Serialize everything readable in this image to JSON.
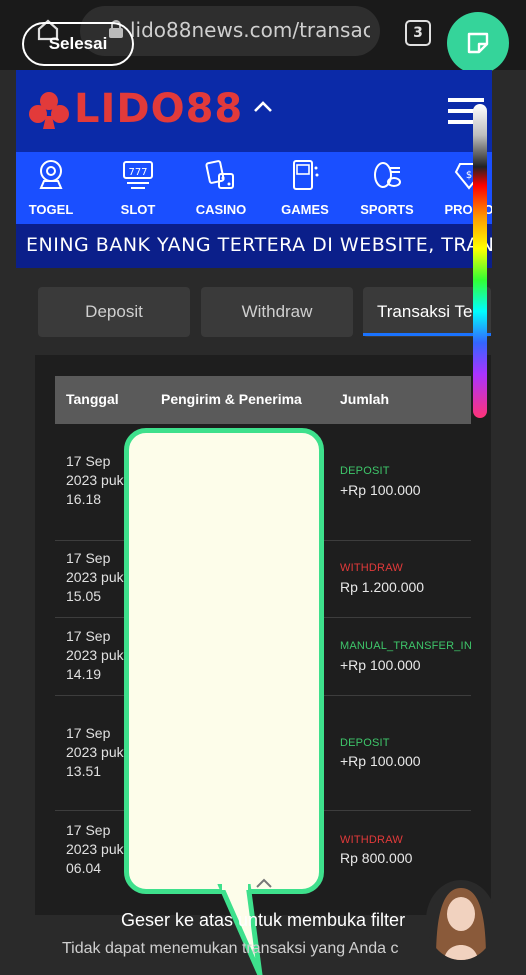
{
  "browser": {
    "url": "lido88news.com/transac",
    "tab_count": "3",
    "done_label": "Selesai"
  },
  "header": {
    "logo_text": "LIDO88"
  },
  "nav": {
    "items": [
      {
        "label": "TOGEL",
        "icon": "lottery-icon"
      },
      {
        "label": "SLOT",
        "icon": "slot-machine-icon"
      },
      {
        "label": "CASINO",
        "icon": "cards-dice-icon"
      },
      {
        "label": "GAMES",
        "icon": "arcade-icon"
      },
      {
        "label": "SPORTS",
        "icon": "sports-icon"
      },
      {
        "label": "PROMO",
        "icon": "promo-icon"
      }
    ]
  },
  "marquee": {
    "text": "ENING BANK YANG TERTERA DI WEBSITE, TRANS"
  },
  "tabs": [
    {
      "label": "Deposit"
    },
    {
      "label": "Withdraw"
    },
    {
      "label": "Transaksi Te"
    }
  ],
  "table": {
    "headers": [
      "Tanggal",
      "Pengirim & Penerima",
      "Jumlah"
    ],
    "rows": [
      {
        "date": "17 Sep 2023 puk 16.18",
        "type": "DEPOSIT",
        "amount": "+Rp 100.000",
        "status": "green"
      },
      {
        "date": "17 Sep 2023 puk 15.05",
        "type": "WITHDRAW",
        "amount": "Rp 1.200.000",
        "status": "red"
      },
      {
        "date": "17 Sep 2023 puk 14.19",
        "type": "MANUAL_TRANSFER_IN",
        "amount": "+Rp 100.000",
        "status": "green"
      },
      {
        "date": "17 Sep 2023 puk 13.51",
        "type": "DEPOSIT",
        "amount": "+Rp 100.000",
        "status": "green"
      },
      {
        "date": "17 Sep 2023 puk 06.04",
        "type": "WITHDRAW",
        "amount": "Rp 800.000",
        "status": "red"
      }
    ]
  },
  "footer": {
    "filter_hint": "Geser ke atas untuk membuka filter",
    "not_found": "Tidak dapat menemukan transaksi yang Anda c"
  },
  "colors": {
    "header_bg": "#0b2aa8",
    "nav_bg": "#1a4fff",
    "accent_green": "#35d49a",
    "deposit_green": "#3ec66a",
    "withdraw_red": "#e23a3a"
  }
}
